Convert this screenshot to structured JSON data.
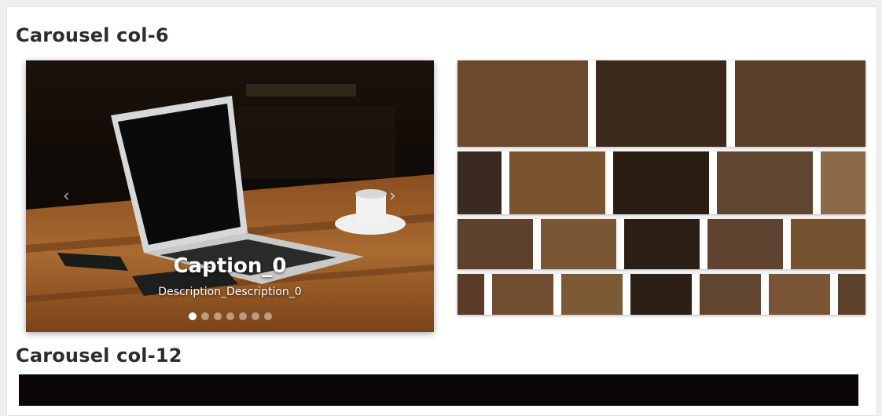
{
  "sections": [
    {
      "title": "Carousel col-6"
    },
    {
      "title": "Carousel col-12"
    }
  ],
  "main_carousel": {
    "caption_title": "Caption_0",
    "caption_description": "Description_Description_0",
    "prev_icon": "chevron-left-icon",
    "next_icon": "chevron-right-icon",
    "prev_glyph": "‹",
    "next_glyph": "›",
    "slide_count": 7,
    "active_slide": 1
  },
  "colors": {
    "background": "#efefef",
    "card": "#ffffff",
    "title": "#2d2d2d",
    "table_wood": "#9a5a26",
    "night": "#0b0706"
  }
}
